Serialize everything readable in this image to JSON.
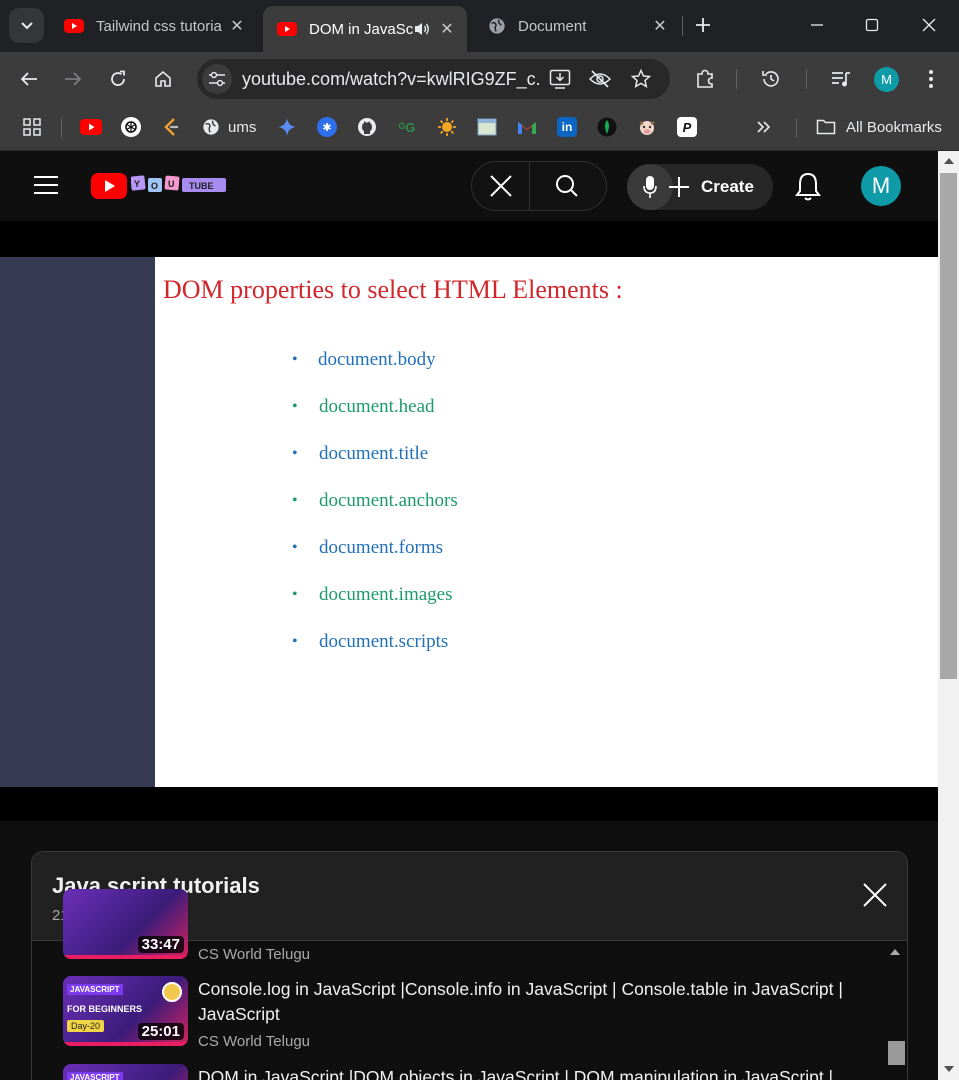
{
  "browser": {
    "tabs": [
      {
        "title": "Tailwind css tutoria",
        "active": false
      },
      {
        "title": "DOM in JavaSc",
        "active": true
      },
      {
        "title": "Document",
        "active": false
      }
    ],
    "omnibox": {
      "url": "youtube.com/watch?v=kwlRIG9ZF_c..."
    },
    "bookmarks": [
      {
        "label": "ums"
      },
      {
        "label": "All Bookmarks"
      }
    ]
  },
  "youtube": {
    "header": {
      "logo_text": "YOUTUBE",
      "create_label": "Create",
      "avatar_letter": "M"
    },
    "video": {
      "slide_title": "DOM properties to select HTML Elements :",
      "items": [
        "document.body",
        "document.head",
        "document.title",
        "document.anchors",
        "document.forms",
        "document.images",
        "document.scripts"
      ]
    },
    "playlist": {
      "title": "Java script tutorials",
      "position": "21 / 104",
      "entries": [
        {
          "title": "",
          "channel": "CS World Telugu",
          "duration": "33:47"
        },
        {
          "title": "Console.log in JavaScript |Console.info in JavaScript | Console.table in JavaScript | JavaScript",
          "channel": "CS World Telugu",
          "duration": "25:01",
          "day": "Day-20",
          "thumb_text": "FOR BEGINNERS"
        },
        {
          "title": "DOM in JavaScript |DOM objects in JavaScript | DOM manipulation in JavaScript |",
          "channel": "",
          "duration": ""
        }
      ]
    }
  },
  "colors": {
    "youtube_red": "#ff0000",
    "slide_title_red": "#d0262c",
    "slide_blue": "#2170b8",
    "slide_green": "#1e9a6b",
    "avatar_teal": "#0e9aa7"
  }
}
